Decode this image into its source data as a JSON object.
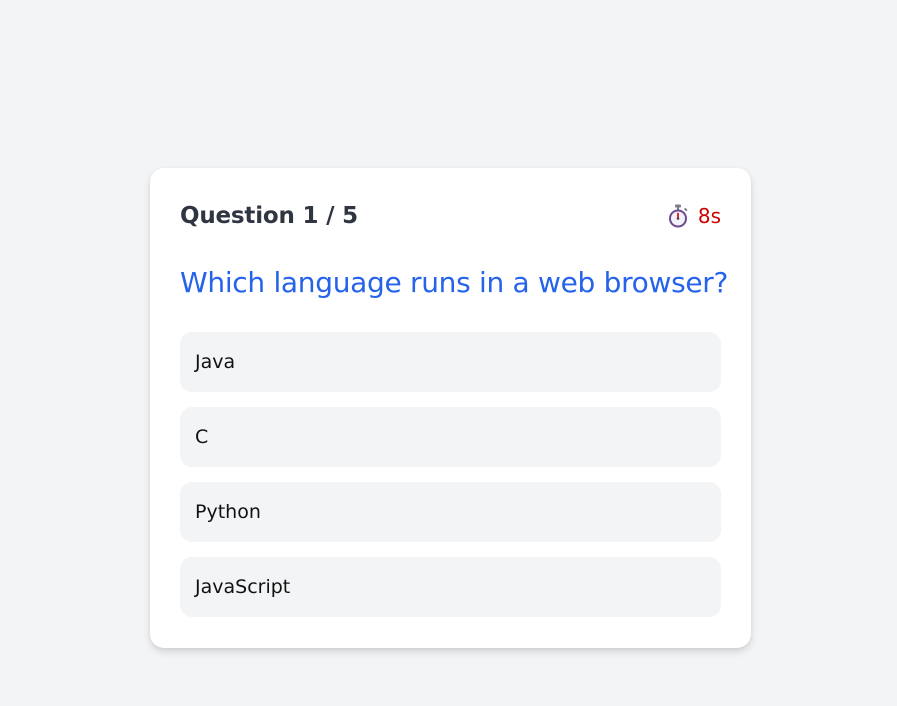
{
  "quiz": {
    "progress_label": "Question 1 / 5",
    "timer": {
      "icon": "stopwatch-icon",
      "value": "8s",
      "color": "#cc0000"
    },
    "question": "Which language runs in a web browser?",
    "options": [
      {
        "label": "Java"
      },
      {
        "label": "C"
      },
      {
        "label": "Python"
      },
      {
        "label": "JavaScript"
      }
    ]
  },
  "colors": {
    "accent": "#2563eb",
    "background": "#f3f4f6",
    "card": "#ffffff",
    "option_bg": "#f3f4f6"
  }
}
